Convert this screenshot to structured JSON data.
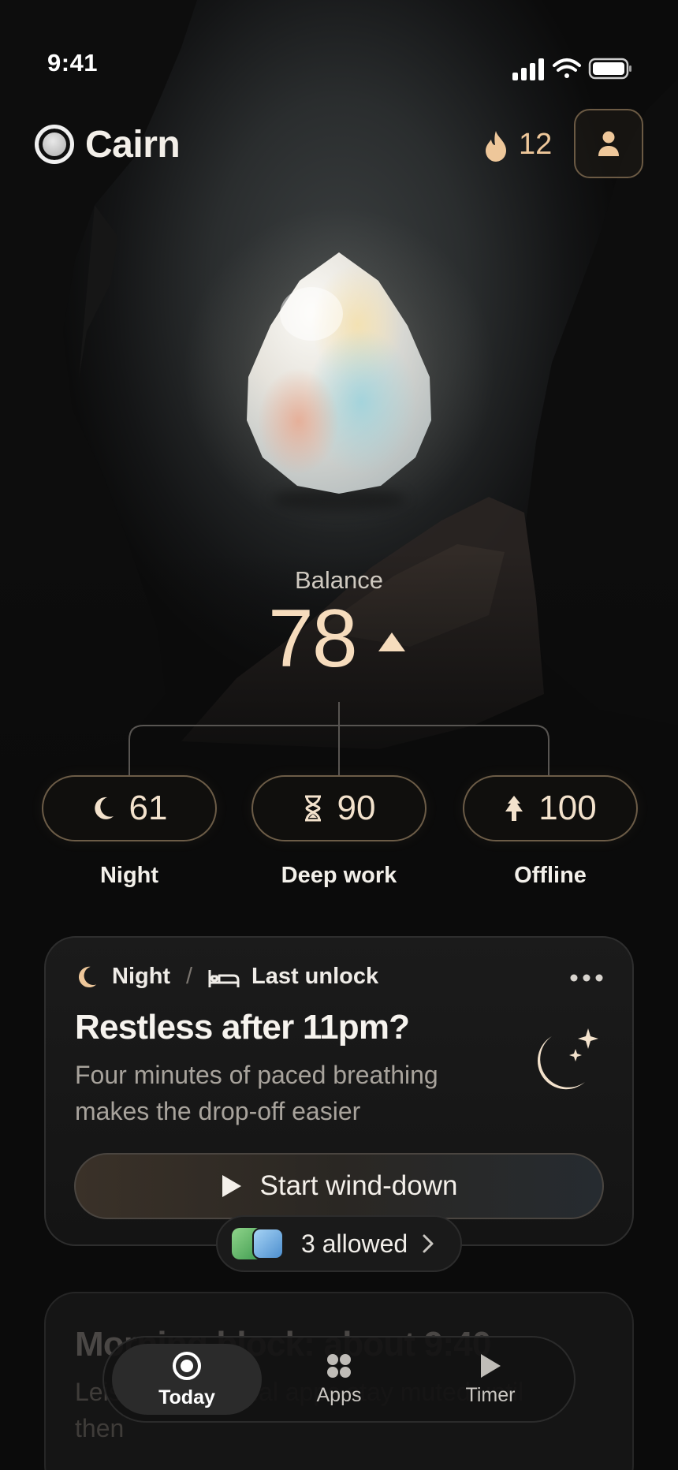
{
  "status_bar": {
    "time": "9:41"
  },
  "header": {
    "app_name": "Cairn",
    "streak_count": "12"
  },
  "balance": {
    "label": "Balance",
    "value": "78",
    "trend": "up"
  },
  "metrics": [
    {
      "icon": "moon-icon",
      "value": "61",
      "label": "Night"
    },
    {
      "icon": "hourglass-icon",
      "value": "90",
      "label": "Deep work"
    },
    {
      "icon": "tree-icon",
      "value": "100",
      "label": "Offline"
    }
  ],
  "card": {
    "category": "Night",
    "separator": "/",
    "source": "Last unlock",
    "title": "Restless after 11pm?",
    "description": "Four minutes of paced breathing makes the drop-off easier",
    "cta_label": "Start wind-down"
  },
  "allowed": {
    "label": "3 allowed"
  },
  "card2": {
    "title": "Morning block: about 9:40",
    "description": "Leisure and social apps stay muted until then"
  },
  "tabs": [
    {
      "label": "Today",
      "icon": "target-icon",
      "active": true
    },
    {
      "label": "Apps",
      "icon": "grid-icon",
      "active": false
    },
    {
      "label": "Timer",
      "icon": "play-icon",
      "active": false
    }
  ],
  "colors": {
    "accent": "#eec79a",
    "accent_text": "#f6dcbd",
    "background": "#0b0b0b",
    "card": "#181818"
  }
}
